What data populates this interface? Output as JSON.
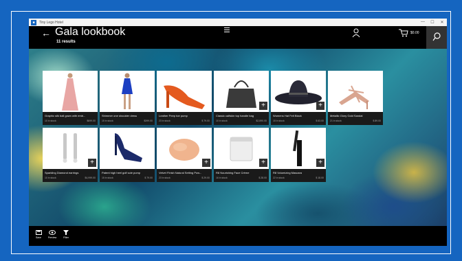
{
  "window": {
    "app_name": "Tiny Lego Hotel",
    "controls": [
      "—",
      "☐",
      "✕"
    ]
  },
  "header": {
    "back_glyph": "←",
    "title": "Gala lookbook",
    "results": "11 results",
    "cart_total": "$0.00"
  },
  "products": [
    {
      "name": "Graphic silk ball gown with emb...",
      "stock": "10 in stock",
      "price": "$699.00",
      "image": "pink-gown"
    },
    {
      "name": "Shimmer one shoulder dress",
      "stock": "15 in stock",
      "price": "$399.00",
      "image": "blue-dress"
    },
    {
      "name": "Leather Peep toe pump",
      "stock": "23 in stock",
      "price": "$ 79.00",
      "image": "orange-pump"
    },
    {
      "name": "Classic calfskin top handle bag",
      "stock": "10 in stock",
      "price": "$2,890.00",
      "image": "black-bag"
    },
    {
      "name": "Womens Hat Felt Black",
      "stock": "15 in stock",
      "price": "$ 63.00",
      "image": "black-hat"
    },
    {
      "name": "Metallic Glory Gold Sandal",
      "stock": "21 in stock",
      "price": "$ 89.00",
      "image": "gold-sandal"
    },
    {
      "name": "Sparkling Diamond earrings",
      "stock": "10 in stock",
      "price": "$4,999.00",
      "image": "earrings"
    },
    {
      "name": "Patent high heel golf sole pump",
      "stock": "15 in stock",
      "price": "$ 79.00",
      "image": "navy-pump"
    },
    {
      "name": "Velvet Finish Natural Setting Pow...",
      "stock": "23 in stock",
      "price": "$ 29.00",
      "image": "powder"
    },
    {
      "name": "R8 Nourishing Face Crème",
      "stock": "16 in stock",
      "price": "$ 28.00",
      "image": "face-cream"
    },
    {
      "name": "R8 Volumizing Mascara",
      "stock": "22 in stock",
      "price": "$ 18.00",
      "image": "mascara"
    }
  ],
  "add_glyph": "+",
  "bottom_bar": [
    {
      "label": "Save",
      "icon": "save-icon"
    },
    {
      "label": "Preview",
      "icon": "eye-icon"
    },
    {
      "label": "Filter",
      "icon": "filter-icon"
    }
  ]
}
